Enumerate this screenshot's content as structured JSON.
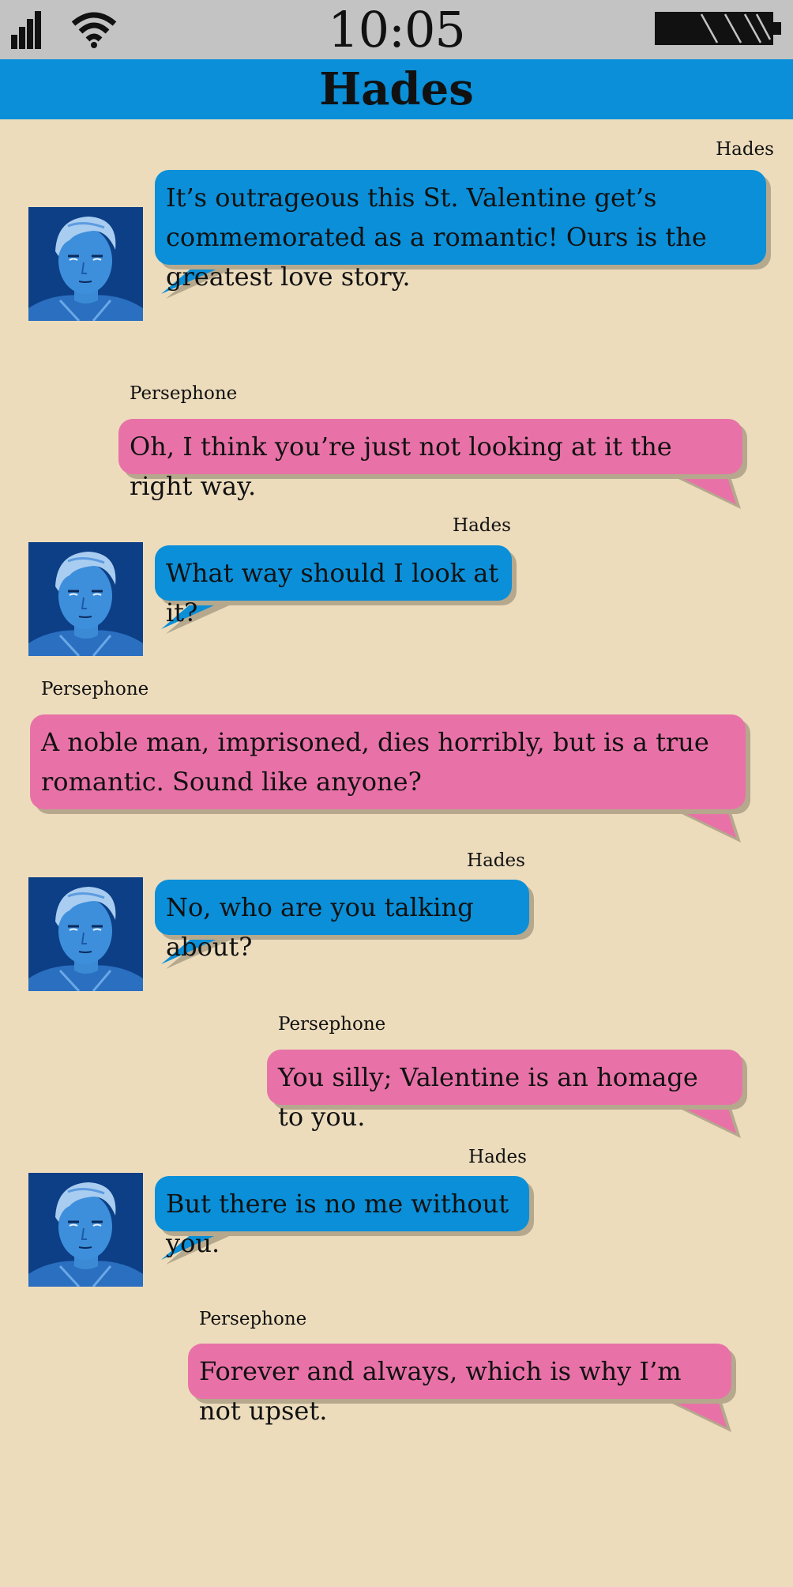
{
  "status_bar": {
    "time": "10:05"
  },
  "header": {
    "title": "Hades"
  },
  "colors": {
    "hades_bubble": "#0a8fd8",
    "persephone_bubble": "#e872a7",
    "background": "#ecdcbc",
    "header": "#0a8fd8"
  },
  "icons": {
    "signal": "signal-bars-icon",
    "wifi": "wifi-icon",
    "battery": "battery-icon"
  },
  "messages": [
    {
      "sender": "Hades",
      "text": "It’s outrageous this St. Valentine get’s commemorated as a romantic! Ours is the greatest love story."
    },
    {
      "sender": "Persephone",
      "text": "Oh, I think you’re just not looking at it the right way."
    },
    {
      "sender": "Hades",
      "text": "What way should I look at it?"
    },
    {
      "sender": "Persephone",
      "text": "A noble man, imprisoned, dies horribly, but is a true romantic. Sound like anyone?"
    },
    {
      "sender": "Hades",
      "text": "No, who are you talking about?"
    },
    {
      "sender": "Persephone",
      "text": "You silly; Valentine is an homage to you."
    },
    {
      "sender": "Hades",
      "text": "But there is no me without you."
    },
    {
      "sender": "Persephone",
      "text": "Forever and always, which is why I’m not upset."
    }
  ]
}
